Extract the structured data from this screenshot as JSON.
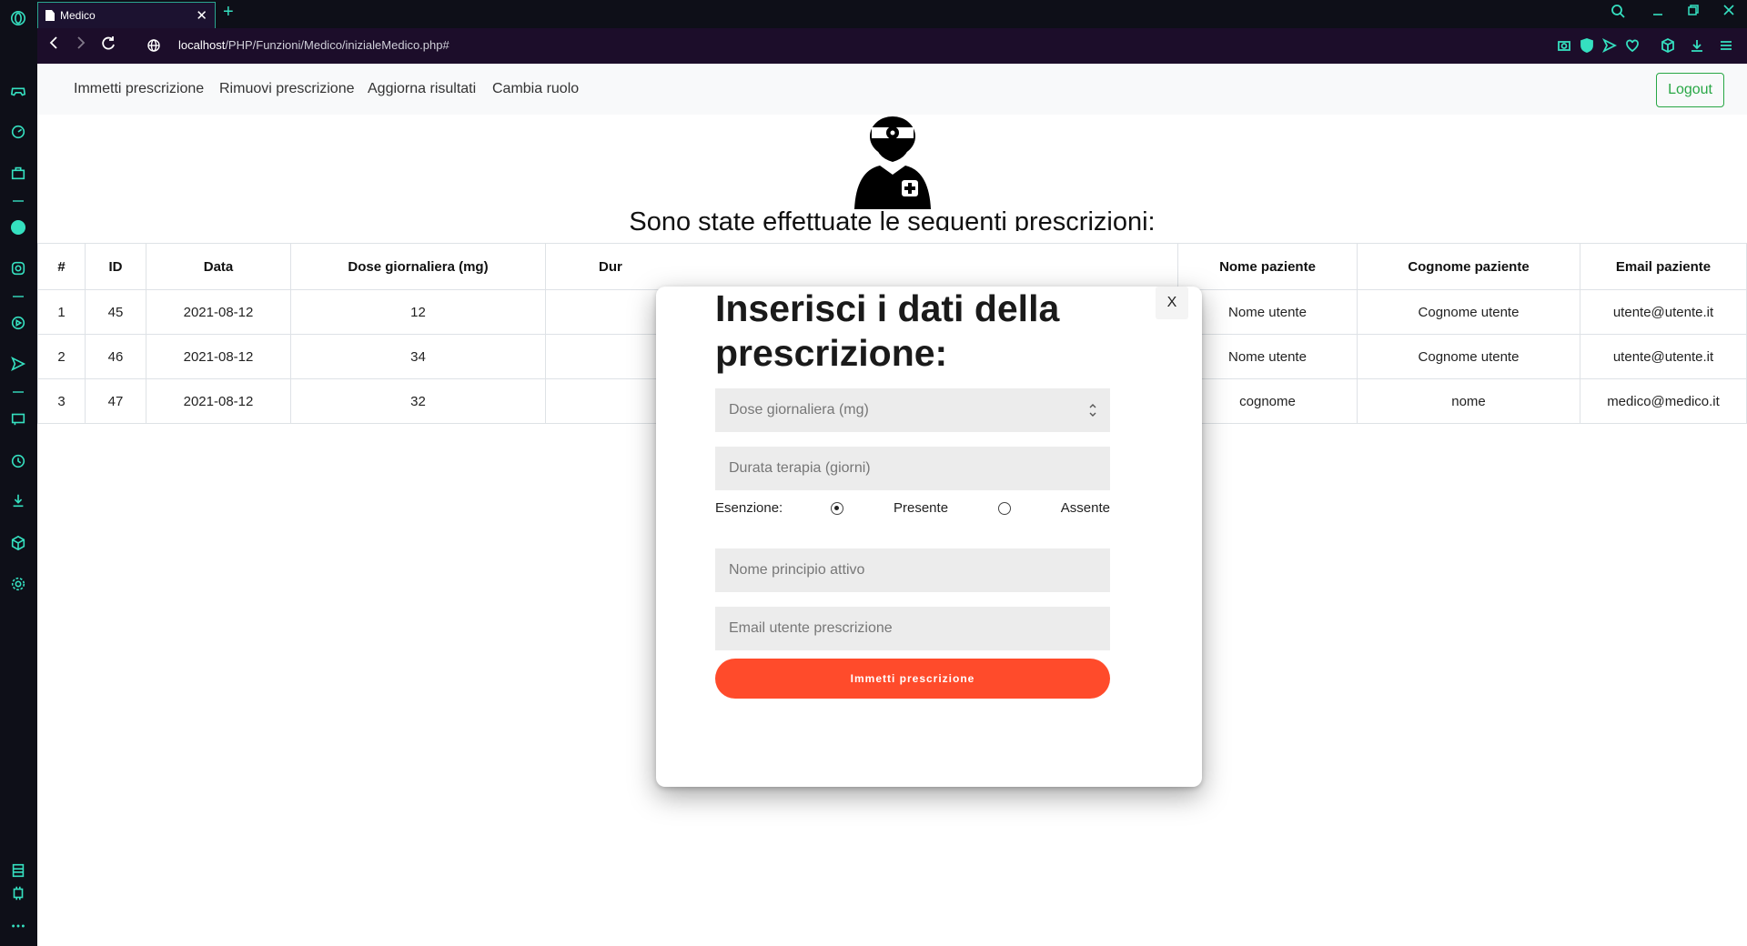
{
  "browser": {
    "tab_title": "Medico",
    "tab_close": "✕",
    "new_tab": "+",
    "url_host": "localhost",
    "url_path": "/PHP/Funzioni/Medico/inizialeMedico.php#"
  },
  "navbar": {
    "links": [
      "Immetti prescrizione",
      "Rimuovi prescrizione",
      "Aggiorna risultati",
      "Cambia ruolo"
    ],
    "logout": "Logout"
  },
  "heading": "Sono state effettuate le seguenti prescrizioni:",
  "table": {
    "headers": [
      "#",
      "ID",
      "Data",
      "Dose giornaliera (mg)",
      "Dur",
      "Nome paziente",
      "Cognome paziente",
      "Email paziente"
    ],
    "rows": [
      [
        "1",
        "45",
        "2021-08-12",
        "12",
        "",
        "Nome utente",
        "Cognome utente",
        "utente@utente.it"
      ],
      [
        "2",
        "46",
        "2021-08-12",
        "34",
        "",
        "Nome utente",
        "Cognome utente",
        "utente@utente.it"
      ],
      [
        "3",
        "47",
        "2021-08-12",
        "32",
        "",
        "cognome",
        "nome",
        "medico@medico.it"
      ]
    ]
  },
  "modal": {
    "close": "X",
    "title": "Inserisci i dati della prescrizione:",
    "dose_placeholder": "Dose giornaliera (mg)",
    "durata_placeholder": "Durata terapia (giorni)",
    "esenzione_label": "Esenzione:",
    "presente_label": "Presente",
    "assente_label": "Assente",
    "esenzione_selected": "Presente",
    "principio_placeholder": "Nome principio attivo",
    "email_placeholder": "Email utente prescrizione",
    "submit": "Immetti prescrizione"
  },
  "colors": {
    "accent": "#35e0c0",
    "submit": "#ff4b2b",
    "logout": "#28a745"
  }
}
